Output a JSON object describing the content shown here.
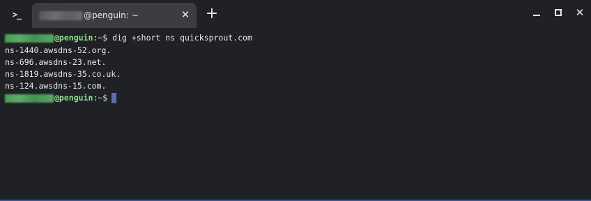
{
  "titlebar": {
    "app_icon": "terminal-prompt-icon",
    "app_icon_glyph": ">_",
    "tab": {
      "title": "@penguin: ~",
      "close_glyph": "✕"
    },
    "new_tab_glyph": "+",
    "window_controls": {
      "minimize": "minimize-icon",
      "maximize": "maximize-icon",
      "close_glyph": "✕"
    }
  },
  "terminal": {
    "prompt_host": "@penguin",
    "prompt_path": ":~$",
    "command": "dig +short ns quicksprout.com",
    "output": [
      "ns-1440.awsdns-52.org.",
      "ns-696.awsdns-23.net.",
      "ns-1819.awsdns-35.co.uk.",
      "ns-124.awsdns-15.com."
    ]
  },
  "colors": {
    "background": "#202124",
    "tab_background": "#3c3d41",
    "prompt_green": "#8ee28a",
    "cursor": "#5b6fb0",
    "text": "#e8eaed"
  }
}
